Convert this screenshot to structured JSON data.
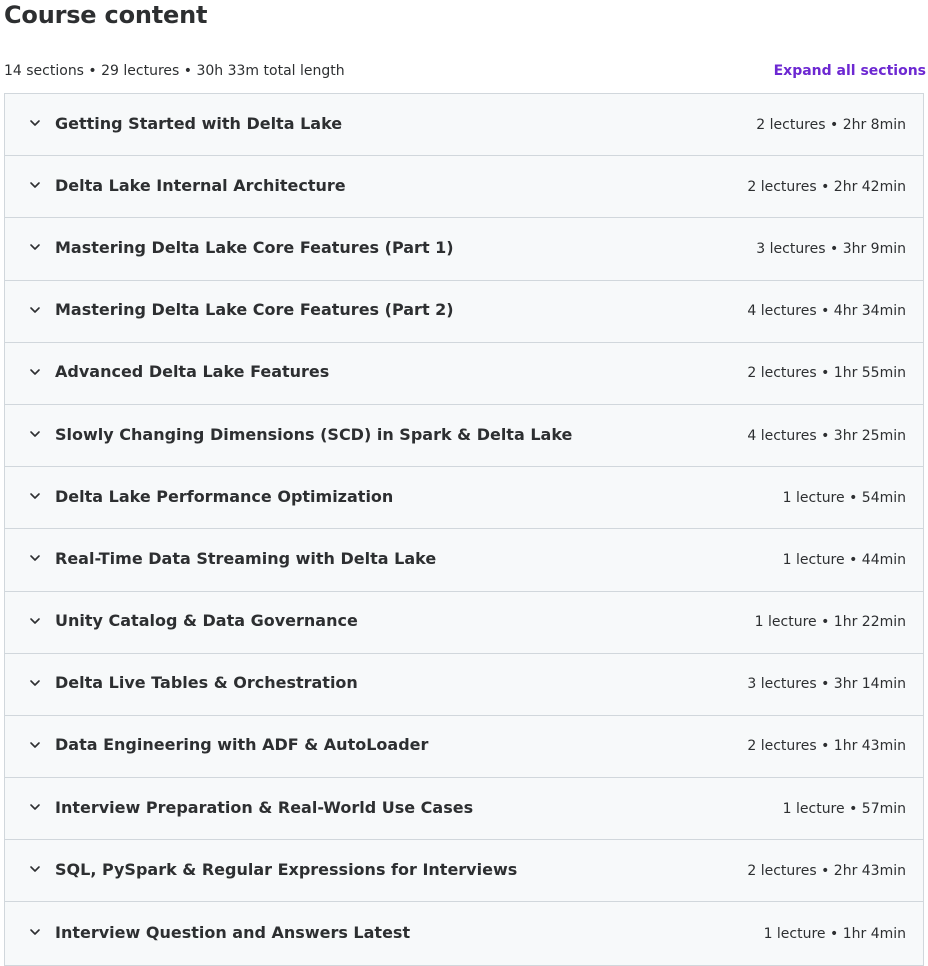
{
  "header": {
    "title": "Course content",
    "summary": "14 sections • 29 lectures • 30h 33m total length",
    "expand_label": "Expand all sections"
  },
  "sections": [
    {
      "title": "Getting Started with Delta Lake",
      "meta": "2 lectures • 2hr 8min"
    },
    {
      "title": "Delta Lake Internal Architecture",
      "meta": "2 lectures • 2hr 42min"
    },
    {
      "title": "Mastering Delta Lake Core Features (Part 1)",
      "meta": "3 lectures • 3hr 9min"
    },
    {
      "title": "Mastering Delta Lake Core Features (Part 2)",
      "meta": "4 lectures • 4hr 34min"
    },
    {
      "title": "Advanced Delta Lake Features",
      "meta": "2 lectures • 1hr 55min"
    },
    {
      "title": "Slowly Changing Dimensions (SCD) in Spark & Delta Lake",
      "meta": "4 lectures • 3hr 25min"
    },
    {
      "title": "Delta Lake Performance Optimization",
      "meta": "1 lecture • 54min"
    },
    {
      "title": "Real-Time Data Streaming with Delta Lake",
      "meta": "1 lecture • 44min"
    },
    {
      "title": "Unity Catalog & Data Governance",
      "meta": "1 lecture • 1hr 22min"
    },
    {
      "title": "Delta Live Tables & Orchestration",
      "meta": "3 lectures • 3hr 14min"
    },
    {
      "title": "Data Engineering with ADF & AutoLoader",
      "meta": "2 lectures • 1hr 43min"
    },
    {
      "title": "Interview Preparation & Real-World Use Cases",
      "meta": "1 lecture • 57min"
    },
    {
      "title": "SQL, PySpark & Regular Expressions for Interviews",
      "meta": "2 lectures • 2hr 43min"
    },
    {
      "title": "Interview Question and Answers Latest",
      "meta": "1 lecture • 1hr 4min"
    }
  ],
  "icons": {
    "section_toggle": "chevron-down-icon"
  },
  "colors": {
    "accent": "#6d28d2",
    "text": "#2d2f31",
    "row_bg": "#f7f9fa",
    "border": "#d1d7dc"
  }
}
